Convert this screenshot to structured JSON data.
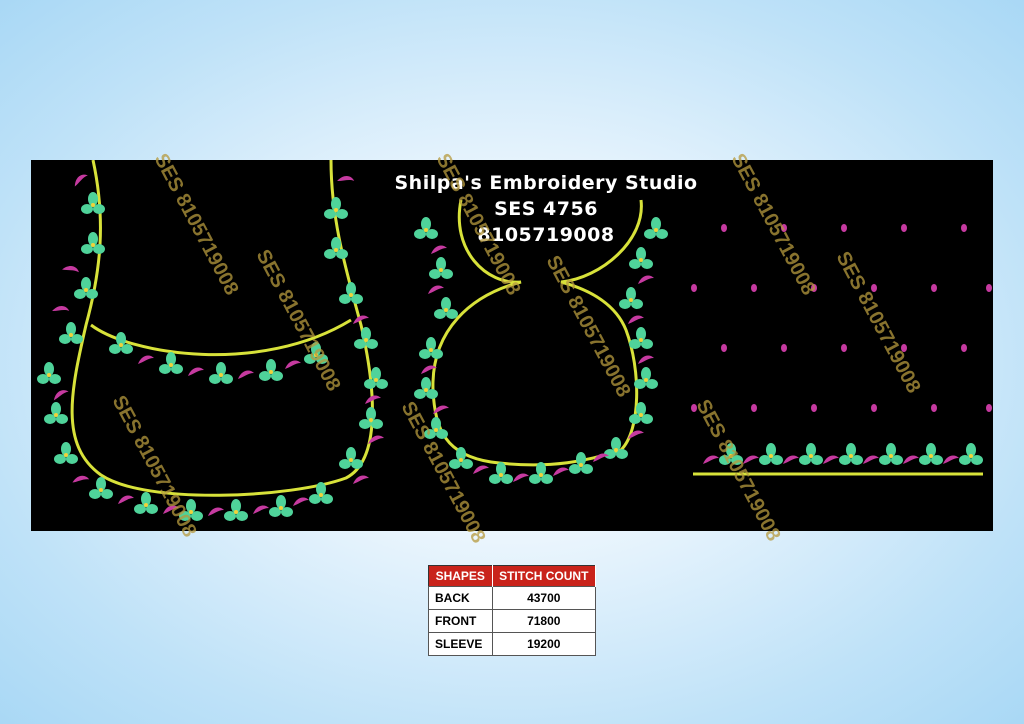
{
  "design": {
    "studio_name": "Shilpa's Embroidery Studio",
    "design_code": "SES  4756",
    "phone": "8105719008",
    "watermark": "SES 8105719008"
  },
  "colors": {
    "background": "#000000",
    "outline": "#d8e23a",
    "leaf_green": "#4fd39a",
    "vine_magenta": "#c63aa0",
    "table_header": "#c9231b"
  },
  "table": {
    "headers": [
      "SHAPES",
      "STITCH COUNT"
    ],
    "rows": [
      {
        "shape": "BACK",
        "count": "43700"
      },
      {
        "shape": "FRONT",
        "count": "71800"
      },
      {
        "shape": "SLEEVE",
        "count": "19200"
      }
    ]
  }
}
